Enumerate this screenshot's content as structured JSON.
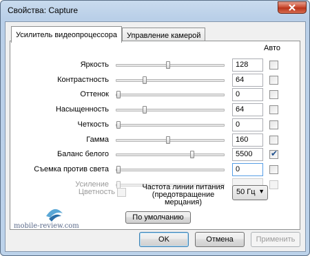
{
  "window": {
    "title": "Свойства: Capture"
  },
  "tabs": [
    {
      "label": "Усилитель видеопроцессора"
    },
    {
      "label": "Управление камерой"
    }
  ],
  "auto_header": "Авто",
  "rows": [
    {
      "label": "Яркость",
      "value": "128",
      "slider_fraction": 0.48,
      "auto_checked": false
    },
    {
      "label": "Контрастность",
      "value": "64",
      "slider_fraction": 0.25,
      "auto_checked": false
    },
    {
      "label": "Оттенок",
      "value": "0",
      "slider_fraction": 0.0,
      "auto_checked": false
    },
    {
      "label": "Насыщенность",
      "value": "64",
      "slider_fraction": 0.25,
      "auto_checked": false
    },
    {
      "label": "Четкость",
      "value": "0",
      "slider_fraction": 0.0,
      "auto_checked": false
    },
    {
      "label": "Гамма",
      "value": "160",
      "slider_fraction": 0.48,
      "auto_checked": false
    },
    {
      "label": "Баланс белого",
      "value": "5500",
      "slider_fraction": 0.71,
      "auto_checked": true
    },
    {
      "label": "Съемка против света",
      "value": "0",
      "slider_fraction": 0.0,
      "auto_checked": false
    },
    {
      "label": "Усиление",
      "value": "",
      "slider_fraction": 0.0,
      "auto_checked": false,
      "disabled": true
    }
  ],
  "color": {
    "label": "Цветность"
  },
  "power_line": {
    "label": "Частота линии питания (предотвращение мерцания)",
    "value": "50 Гц"
  },
  "defaults_button": "По умолчанию",
  "watermark": "mobile-review.com",
  "buttons": {
    "ok": "OK",
    "cancel": "Отмена",
    "apply": "Применить"
  }
}
